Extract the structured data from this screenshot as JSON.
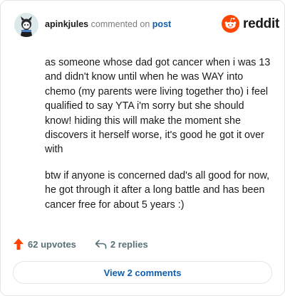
{
  "comment": {
    "username": "apinkjules",
    "action_text": "commented on",
    "post_link_label": "post",
    "paragraphs": [
      "as someone whose dad got cancer when i was 13 and didn't know until when he was WAY into chemo (my parents were living together tho) i feel qualified to say YTA i'm sorry but she should know! hiding this will make the moment she discovers it herself worse, it's good he got it over with",
      "btw if anyone is concerned dad's all good for now, he got through it after a long battle and has been cancer free for about 5 years :)"
    ]
  },
  "brand": {
    "wordmark": "reddit",
    "color": "#ff4500"
  },
  "footer": {
    "upvotes_label": "62 upvotes",
    "replies_label": "2 replies",
    "view_comments_label": "View 2 comments"
  },
  "icons": {
    "avatar": "user-avatar",
    "logo": "reddit-snoo-icon",
    "upvote": "upvote-arrow-icon",
    "reply": "reply-arrow-icon"
  },
  "colors": {
    "upvote": "#ff4500",
    "link": "#0f5fae",
    "muted": "#576f76"
  }
}
